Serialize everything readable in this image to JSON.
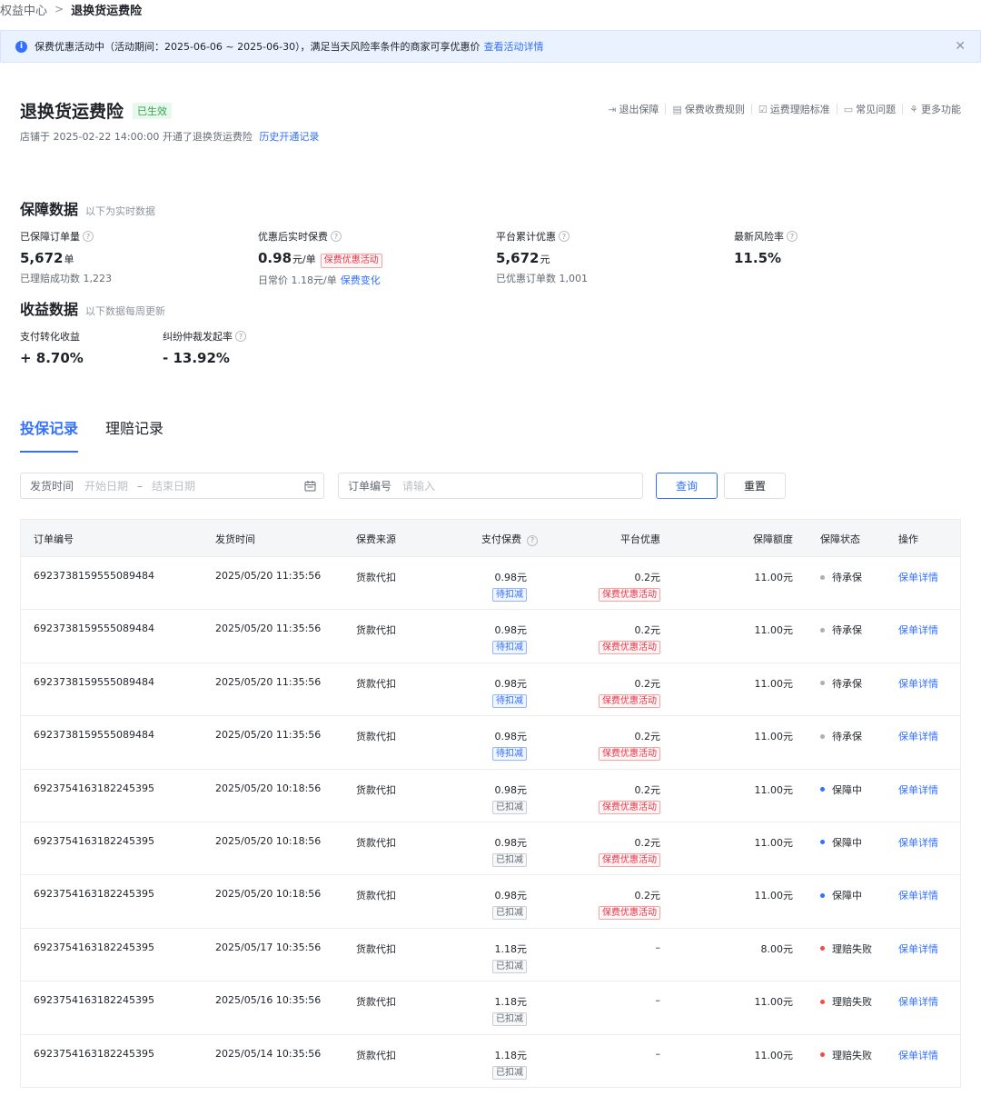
{
  "breadcrumb": {
    "parent": "权益中心",
    "separator": ">",
    "current": "退换货运费险"
  },
  "notice": {
    "icon": "info-icon",
    "text": "保费优惠活动中（活动期间：2025-06-06 ~ 2025-06-30），满足当天风险率条件的商家可享优惠价",
    "link": "查看活动详情",
    "close": "✕"
  },
  "header": {
    "title": "退换货运费险",
    "status_badge": "已生效",
    "subtitle": "店铺于 2025-02-22 14:00:00 开通了退换货运费险",
    "history_link": "历史开通记录",
    "actions": [
      {
        "label": "退出保障",
        "icon": "exit-icon",
        "glyph": "⇥"
      },
      {
        "label": "保费收费规则",
        "icon": "document-icon",
        "glyph": "▤"
      },
      {
        "label": "运费理赔标准",
        "icon": "checklist-icon",
        "glyph": "☑"
      },
      {
        "label": "常见问题",
        "icon": "chat-icon",
        "glyph": "▭"
      },
      {
        "label": "更多功能",
        "icon": "apps-icon",
        "glyph": "⚘"
      }
    ]
  },
  "protection": {
    "title": "保障数据",
    "subtitle": "以下为实时数据",
    "metrics": [
      {
        "label": "已保障订单量",
        "value": "5,672",
        "unit": "单",
        "note": "已理赔成功数 1,223"
      },
      {
        "label": "优惠后实时保费",
        "value": "0.98",
        "unit": "元/单",
        "tag": "保费优惠活动",
        "note": "日常价 1.18元/单",
        "note_link": "保费变化"
      },
      {
        "label": "平台累计优惠",
        "value": "5,672",
        "unit": "元",
        "note": "已优惠订单数 1,001"
      },
      {
        "label": "最新风险率",
        "value": "11.5%"
      }
    ]
  },
  "income": {
    "title": "收益数据",
    "subtitle": "以下数据每周更新",
    "metrics": [
      {
        "label": "支付转化收益",
        "value": "+ 8.70%"
      },
      {
        "label": "纠纷仲裁发起率",
        "value": "- 13.92%"
      }
    ]
  },
  "tabs": [
    {
      "label": "投保记录",
      "active": true
    },
    {
      "label": "理赔记录",
      "active": false
    }
  ],
  "filters": {
    "ship_time_label": "发货时间",
    "start_placeholder": "开始日期",
    "range_separator": "–",
    "end_placeholder": "结束日期",
    "order_label": "订单编号",
    "order_placeholder": "请输入",
    "query_button": "查询",
    "reset_button": "重置"
  },
  "table": {
    "columns": [
      "订单编号",
      "发货时间",
      "保费来源",
      "支付保费",
      "平台优惠",
      "保障额度",
      "保障状态",
      "操作"
    ],
    "rows": [
      {
        "order": "6923738159555089484",
        "time": "2025/05/20 11:35:56",
        "source": "货款代扣",
        "fee": "0.98元",
        "fee_tag": "待扣减",
        "fee_tag_style": "blue",
        "discount": "0.2元",
        "discount_tag": "保费优惠活动",
        "amount": "11.00元",
        "status": "待承保",
        "status_color": "#a9aeb8",
        "op": "保单详情"
      },
      {
        "order": "6923738159555089484",
        "time": "2025/05/20 11:35:56",
        "source": "货款代扣",
        "fee": "0.98元",
        "fee_tag": "待扣减",
        "fee_tag_style": "blue",
        "discount": "0.2元",
        "discount_tag": "保费优惠活动",
        "amount": "11.00元",
        "status": "待承保",
        "status_color": "#a9aeb8",
        "op": "保单详情"
      },
      {
        "order": "6923738159555089484",
        "time": "2025/05/20 11:35:56",
        "source": "货款代扣",
        "fee": "0.98元",
        "fee_tag": "待扣减",
        "fee_tag_style": "blue",
        "discount": "0.2元",
        "discount_tag": "保费优惠活动",
        "amount": "11.00元",
        "status": "待承保",
        "status_color": "#a9aeb8",
        "op": "保单详情"
      },
      {
        "order": "6923738159555089484",
        "time": "2025/05/20 11:35:56",
        "source": "货款代扣",
        "fee": "0.98元",
        "fee_tag": "待扣减",
        "fee_tag_style": "blue",
        "discount": "0.2元",
        "discount_tag": "保费优惠活动",
        "amount": "11.00元",
        "status": "待承保",
        "status_color": "#a9aeb8",
        "op": "保单详情"
      },
      {
        "order": "6923754163182245395",
        "time": "2025/05/20 10:18:56",
        "source": "货款代扣",
        "fee": "0.98元",
        "fee_tag": "已扣减",
        "fee_tag_style": "gray",
        "discount": "0.2元",
        "discount_tag": "保费优惠活动",
        "amount": "11.00元",
        "status": "保障中",
        "status_color": "#3370ff",
        "op": "保单详情"
      },
      {
        "order": "6923754163182245395",
        "time": "2025/05/20 10:18:56",
        "source": "货款代扣",
        "fee": "0.98元",
        "fee_tag": "已扣减",
        "fee_tag_style": "gray",
        "discount": "0.2元",
        "discount_tag": "保费优惠活动",
        "amount": "11.00元",
        "status": "保障中",
        "status_color": "#3370ff",
        "op": "保单详情"
      },
      {
        "order": "6923754163182245395",
        "time": "2025/05/20 10:18:56",
        "source": "货款代扣",
        "fee": "0.98元",
        "fee_tag": "已扣减",
        "fee_tag_style": "gray",
        "discount": "0.2元",
        "discount_tag": "保费优惠活动",
        "amount": "11.00元",
        "status": "保障中",
        "status_color": "#3370ff",
        "op": "保单详情"
      },
      {
        "order": "6923754163182245395",
        "time": "2025/05/17 10:35:56",
        "source": "货款代扣",
        "fee": "1.18元",
        "fee_tag": "已扣减",
        "fee_tag_style": "gray",
        "discount": "–",
        "discount_tag": "",
        "amount": "8.00元",
        "status": "理赔失败",
        "status_color": "#f54a45",
        "op": "保单详情"
      },
      {
        "order": "6923754163182245395",
        "time": "2025/05/16 10:35:56",
        "source": "货款代扣",
        "fee": "1.18元",
        "fee_tag": "已扣减",
        "fee_tag_style": "gray",
        "discount": "–",
        "discount_tag": "",
        "amount": "11.00元",
        "status": "理赔失败",
        "status_color": "#f54a45",
        "op": "保单详情"
      },
      {
        "order": "6923754163182245395",
        "time": "2025/05/14 10:35:56",
        "source": "货款代扣",
        "fee": "1.18元",
        "fee_tag": "已扣减",
        "fee_tag_style": "gray",
        "discount": "–",
        "discount_tag": "",
        "amount": "11.00元",
        "status": "理赔失败",
        "status_color": "#f54a45",
        "op": "保单详情"
      }
    ]
  }
}
